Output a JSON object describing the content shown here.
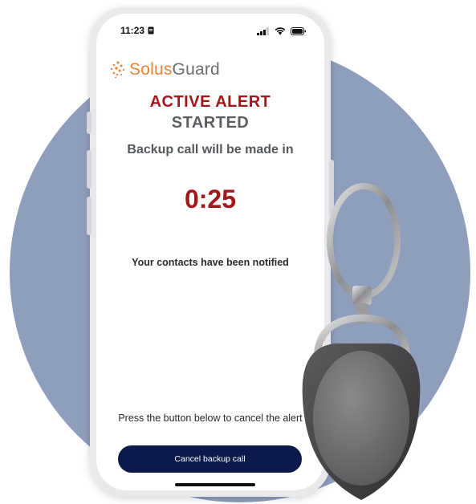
{
  "status_bar": {
    "time": "11:23"
  },
  "icons": {
    "sim": "sim-card-icon",
    "signal": "signal-icon",
    "wifi": "wifi-icon",
    "battery": "battery-icon",
    "logo": "solusguard-logo-icon"
  },
  "logo": {
    "brand_first": "Solus",
    "brand_second": "Guard"
  },
  "alert": {
    "title": "ACTIVE ALERT",
    "subtitle": "STARTED",
    "backup_text": "Backup call will be made in",
    "countdown": "0:25",
    "notified": "Your contacts have been notified",
    "cancel_instruction": "Press the button below to cancel the alert",
    "cancel_button": "Cancel backup call"
  },
  "colors": {
    "background_circle": "#8f9ebd",
    "alert_red": "#a3171b",
    "brand_orange": "#e7833a",
    "button_navy": "#0b1a4a"
  }
}
